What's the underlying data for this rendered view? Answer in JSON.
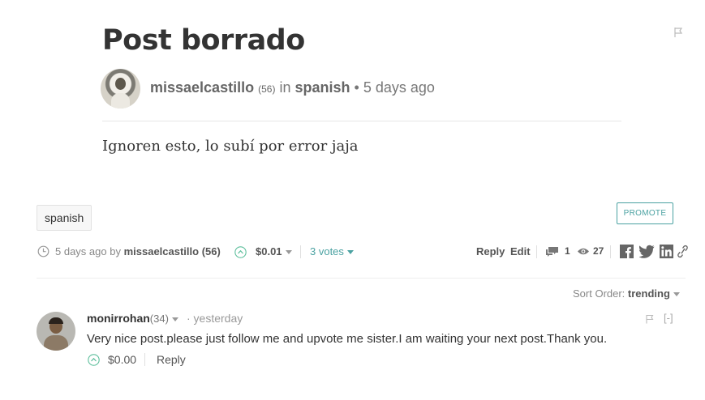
{
  "post": {
    "title": "Post borrado",
    "author": "missaelcastillo",
    "author_rep": "(56)",
    "in_label": "in",
    "category": "spanish",
    "bullet": "•",
    "age": "5 days ago",
    "body": "Ignoren esto, lo subí por error jaja"
  },
  "tags": [
    "spanish"
  ],
  "promote_label": "PROMOTE",
  "footer": {
    "age": "5 days ago by",
    "author": "missaelcastillo",
    "author_rep": "(56)",
    "payout": "$0.01",
    "votes": "3 votes",
    "reply_label": "Reply",
    "edit_label": "Edit",
    "comments_count": "1",
    "views_count": "27"
  },
  "sort": {
    "label": "Sort Order:",
    "value": "trending"
  },
  "comment": {
    "author": "monirrohan",
    "author_rep": "(34)",
    "time": "· yesterday",
    "collapse": "[-]",
    "body": "Very nice post.please just follow me and upvote me sister.I am waiting your next post.Thank you.",
    "payout": "$0.00",
    "reply_label": "Reply"
  },
  "icons": {
    "share": [
      "facebook-icon",
      "twitter-icon",
      "linkedin-icon",
      "link-icon"
    ]
  },
  "colors": {
    "accent": "#4ba2a2",
    "upvote": "#5dbf9c"
  }
}
